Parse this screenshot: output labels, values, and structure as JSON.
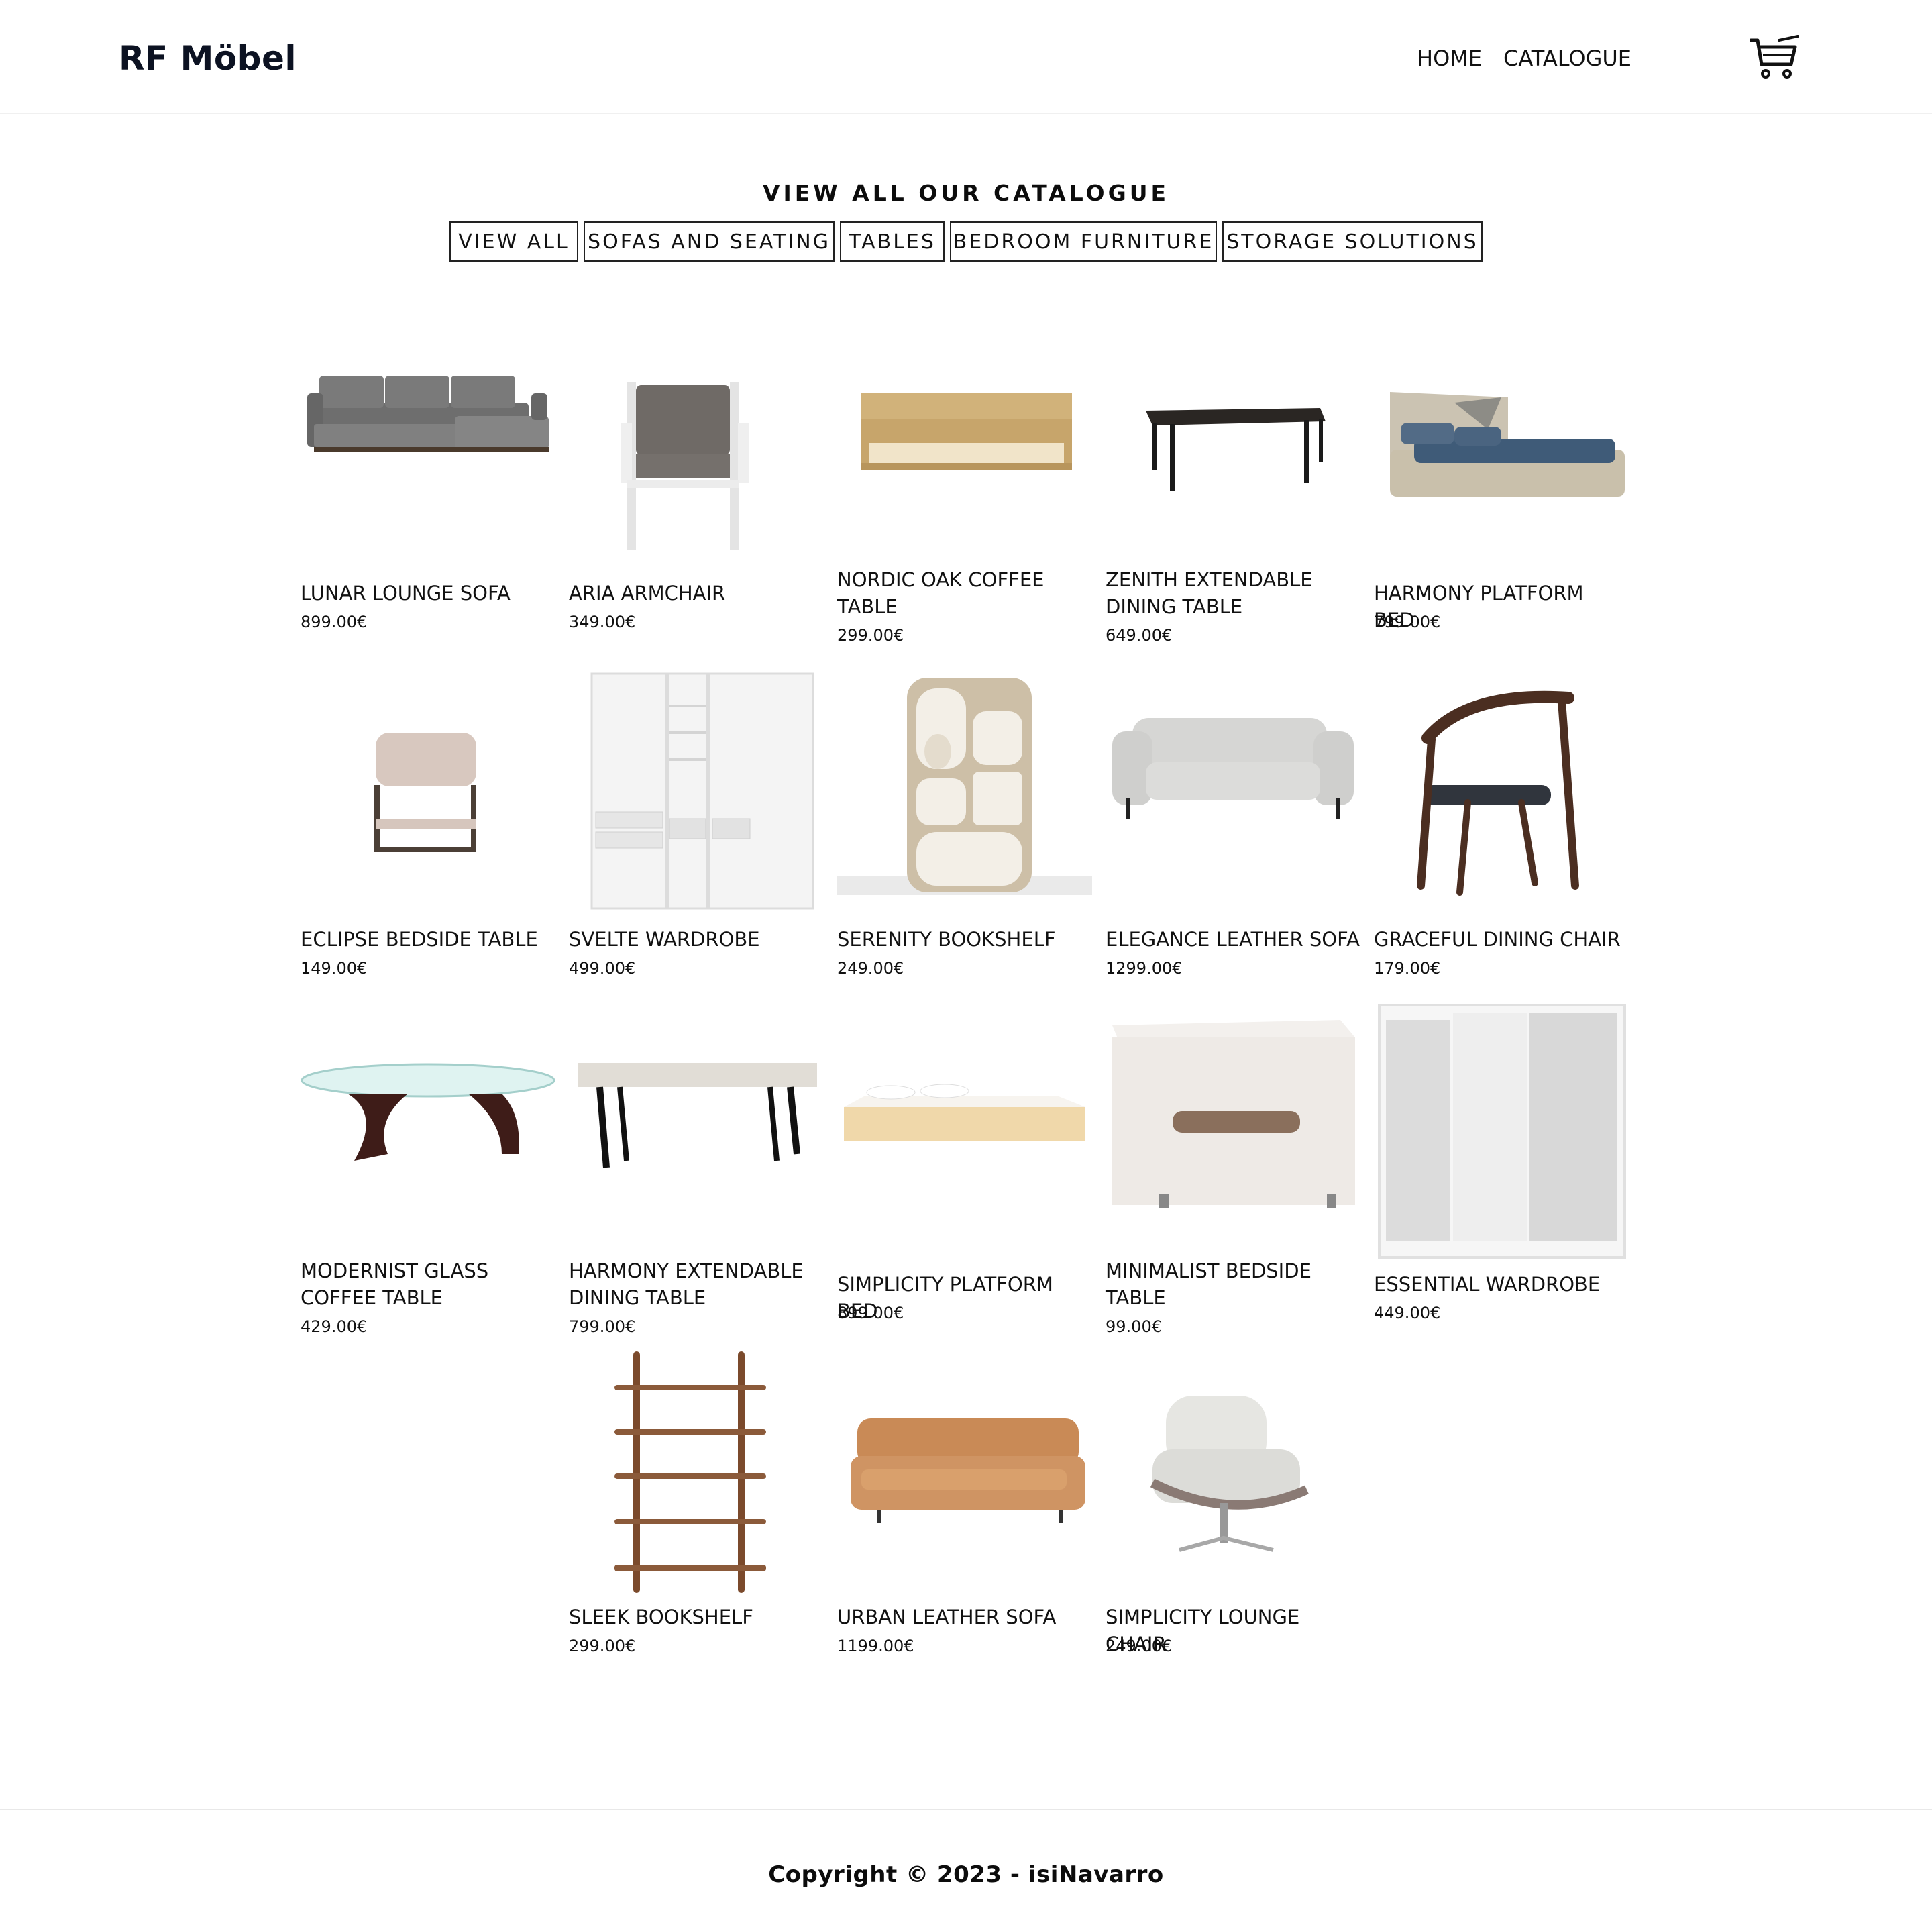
{
  "brand": "RF Möbel",
  "nav": {
    "home": "HOME",
    "catalogue": "CATALOGUE",
    "cart_icon": "shopping-cart-icon"
  },
  "catalogue": {
    "title": "VIEW ALL OUR CATALOGUE",
    "filters": [
      "VIEW ALL",
      "SOFAS AND SEATING",
      "TABLES",
      "BEDROOM FURNITURE",
      "STORAGE SOLUTIONS"
    ]
  },
  "products": [
    {
      "name": "LUNAR LOUNGE SOFA",
      "price": "899.00€",
      "image": "sofa-sectional"
    },
    {
      "name": "ARIA ARMCHAIR",
      "price": "349.00€",
      "image": "armchair-white"
    },
    {
      "name": "NORDIC OAK COFFEE TABLE",
      "price": "299.00€",
      "image": "coffee-table-oak"
    },
    {
      "name": "ZENITH EXTENDABLE DINING TABLE",
      "price": "649.00€",
      "image": "dining-table-black"
    },
    {
      "name": "HARMONY PLATFORM BED",
      "price": "799.00€",
      "image": "bed-beige"
    },
    {
      "name": "ECLIPSE BEDSIDE TABLE",
      "price": "149.00€",
      "image": "bedside-stool"
    },
    {
      "name": "SVELTE WARDROBE",
      "price": "499.00€",
      "image": "wardrobe-open"
    },
    {
      "name": "SERENITY BOOKSHELF",
      "price": "249.00€",
      "image": "bookshelf-arched"
    },
    {
      "name": "ELEGANCE LEATHER SOFA",
      "price": "1299.00€",
      "image": "sofa-grey-leather"
    },
    {
      "name": "GRACEFUL DINING CHAIR",
      "price": "179.00€",
      "image": "chair-wood"
    },
    {
      "name": "MODERNIST GLASS COFFEE TABLE",
      "price": "429.00€",
      "image": "glass-coffee-table"
    },
    {
      "name": "HARMONY EXTENDABLE DINING TABLE",
      "price": "799.00€",
      "image": "dining-table-concrete"
    },
    {
      "name": "SIMPLICITY PLATFORM BED",
      "price": "899.00€",
      "image": "bed-pine"
    },
    {
      "name": "MINIMALIST BEDSIDE TABLE",
      "price": "99.00€",
      "image": "bedside-white"
    },
    {
      "name": "ESSENTIAL WARDROBE",
      "price": "449.00€",
      "image": "wardrobe-mirror"
    },
    {
      "name": "SLEEK BOOKSHELF",
      "price": "299.00€",
      "image": "bookshelf-ladder"
    },
    {
      "name": "URBAN LEATHER SOFA",
      "price": "1199.00€",
      "image": "sofa-tan-leather"
    },
    {
      "name": "SIMPLICITY LOUNGE CHAIR",
      "price": "249.00€",
      "image": "lounge-chair"
    }
  ],
  "footer": {
    "copyright": "Copyright © 2023 - isiNavarro"
  }
}
